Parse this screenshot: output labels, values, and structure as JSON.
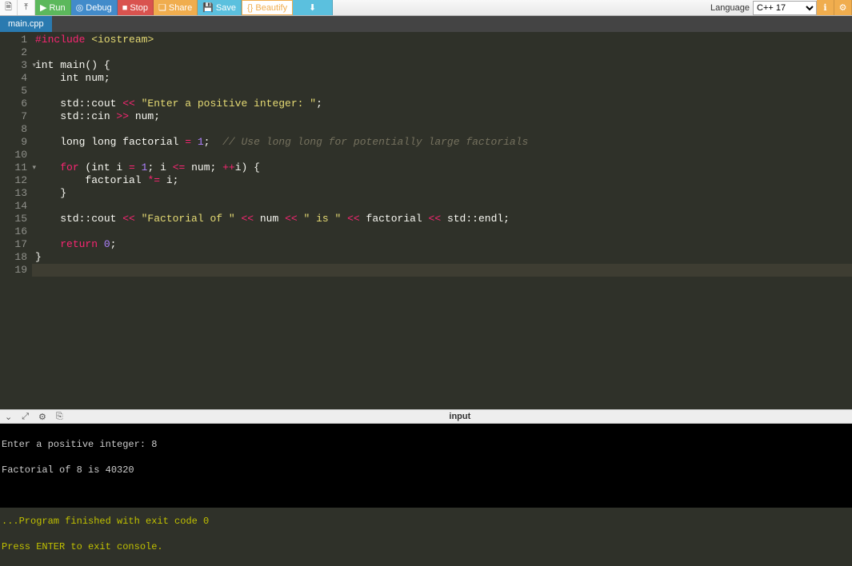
{
  "toolbar": {
    "run": "Run",
    "debug": "Debug",
    "stop": "Stop",
    "share": "Share",
    "save": "Save",
    "beautify": "Beautify",
    "language_label": "Language",
    "language_value": "C++ 17"
  },
  "tab": {
    "filename": "main.cpp"
  },
  "gutter": [
    "1",
    "2",
    "3",
    "4",
    "5",
    "6",
    "7",
    "8",
    "9",
    "10",
    "11",
    "12",
    "13",
    "14",
    "15",
    "16",
    "17",
    "18",
    "19"
  ],
  "code": {
    "l1_include": "#include",
    "l1_lib": "<iostream>",
    "l3_a": "int main() {",
    "l4": "    int num;",
    "l6_a": "    std::cout ",
    "l6_op": "<<",
    "l6_str": " \"Enter a positive integer: \"",
    "l6_end": ";",
    "l7_a": "    std::cin ",
    "l7_op": ">>",
    "l7_b": " num;",
    "l9_a": "    long long factorial ",
    "l9_eq": "=",
    "l9_sp": " ",
    "l9_num": "1",
    "l9_end": ";  ",
    "l9_comment": "// Use long long for potentially large factorials",
    "l11_for": "for",
    "l11_a": " (int i ",
    "l11_eq": "=",
    "l11_sp1": " ",
    "l11_one": "1",
    "l11_b": "; i ",
    "l11_le": "<=",
    "l11_c": " num; ",
    "l11_inc": "++",
    "l11_d": "i) {",
    "l12_a": "        factorial ",
    "l12_op": "*=",
    "l12_b": " i;",
    "l13": "    }",
    "l15_a": "    std::cout ",
    "l15_op1": "<<",
    "l15_s1": " \"Factorial of \" ",
    "l15_op2": "<<",
    "l15_m": " num ",
    "l15_op3": "<<",
    "l15_s2": " \" is \" ",
    "l15_op4": "<<",
    "l15_f": " factorial ",
    "l15_op5": "<<",
    "l15_e": " std::endl;",
    "l17_ret": "return",
    "l17_sp": " ",
    "l17_zero": "0",
    "l17_end": ";",
    "l18": "}"
  },
  "status": {
    "input_label": "input"
  },
  "console": {
    "line1": "Enter a positive integer: 8",
    "line2": "Factorial of 8 is 40320",
    "blank": "",
    "exit": "...Program finished with exit code 0",
    "press": "Press ENTER to exit console."
  },
  "chart_data": null
}
